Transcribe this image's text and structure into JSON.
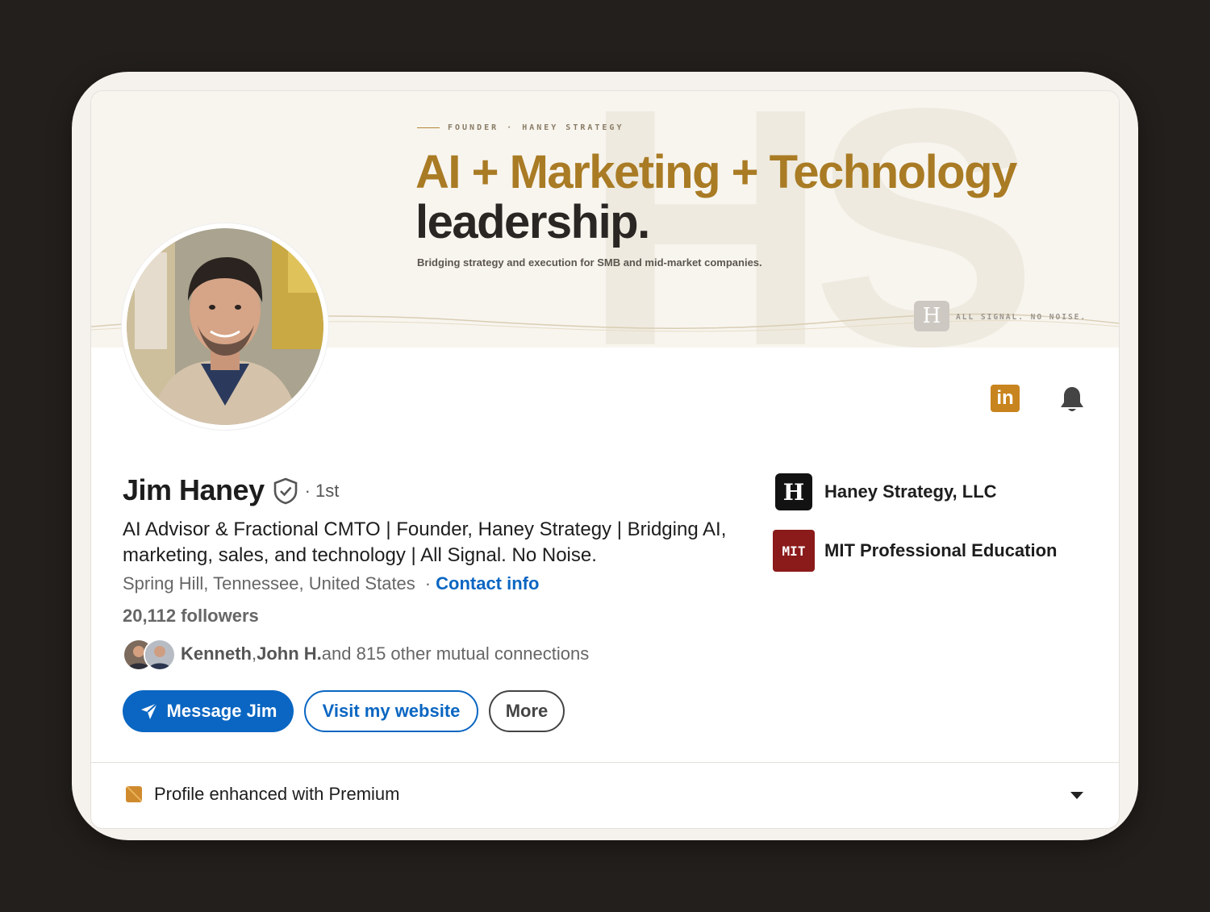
{
  "banner": {
    "eyebrow_1": "FOUNDER",
    "eyebrow_sep": "·",
    "eyebrow_2": "HANEY STRATEGY",
    "headline_line1": "AI + Marketing + Technology",
    "headline_line2": "leadership.",
    "subtitle": "Bridging strategy and execution for SMB and mid-market companies.",
    "logo_letter": "H",
    "tagline": "ALL SIGNAL. NO NOISE.",
    "monogram": "HS",
    "accent_color": "#a97b24"
  },
  "profile": {
    "name": "Jim Haney",
    "degree": "· 1st",
    "headline": "AI Advisor & Fractional CMTO | Founder, Haney Strategy | Bridging AI, marketing, sales, and technology | All Signal. No Noise.",
    "location": "Spring Hill, Tennessee, United States",
    "location_sep": "·",
    "contact_label": "Contact info",
    "followers": "20,112 followers",
    "mutual_name_1": "Kenneth",
    "mutual_comma": ", ",
    "mutual_name_2": "John H.",
    "mutual_rest": " and 815 other mutual connections"
  },
  "actions": {
    "message_label": "Message Jim",
    "website_label": "Visit my website",
    "more_label": "More"
  },
  "companies": [
    {
      "name": "Haney Strategy, LLC",
      "logo_text": "H",
      "color": "#121212"
    },
    {
      "name": "MIT Professional Education",
      "logo_text": "MIT",
      "color": "#8b1a1a"
    }
  ],
  "icons": {
    "linkedin_text": "in",
    "linkedin_color": "#c8841e"
  },
  "premium": {
    "label": "Profile enhanced with Premium"
  },
  "brand_blue": "#0a66c2"
}
